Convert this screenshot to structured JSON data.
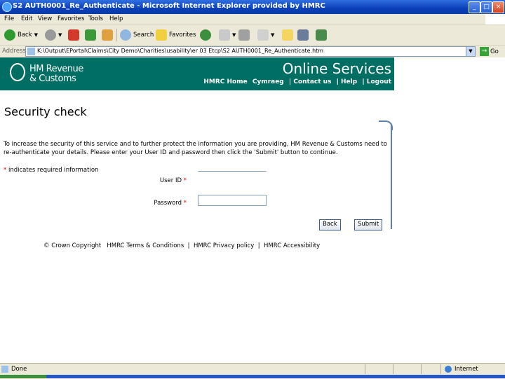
{
  "window": {
    "title": "S2 AUTH0001_Re_Authenticate - Microsoft Internet Explorer provided by HMRC"
  },
  "menu": {
    "items": [
      "File",
      "Edit",
      "View",
      "Favorites",
      "Tools",
      "Help"
    ]
  },
  "toolbar": {
    "back": "Back",
    "search": "Search",
    "favorites": "Favorites"
  },
  "address": {
    "label": "Address",
    "url": "K:\\Output\\EPortal\\Claims\\City Demo\\Charities\\usability\\er 03 Etcp\\S2 AUTH0001_Re_Authenticate.htm",
    "go": "Go"
  },
  "banner": {
    "logo_line1": "HM Revenue",
    "logo_line2": "& Customs",
    "service": "Online Services",
    "nav": [
      "HMRC Home",
      "Cymraeg",
      "| Contact us",
      "| Help",
      "| Logout"
    ]
  },
  "page": {
    "title": "Security check",
    "intro": "To increase the security of this service and to further protect the information you are providing, HM Revenue & Customs need to re-authenticate your details. Please enter your User ID and password then click the 'Submit' button to continue.",
    "required_note": "indicates required information",
    "star": "*",
    "userid_label": "User ID",
    "password_label": "Password",
    "userid_value": "",
    "password_value": "",
    "back_button": "Back",
    "submit_button": "Submit"
  },
  "footer": {
    "copyright": "© Crown Copyright",
    "links": [
      "HMRC Terms & Conditions",
      "HMRC Privacy policy",
      "HMRC Accessibility"
    ],
    "separator": "|"
  },
  "status": {
    "text": "Done",
    "zone": "Internet"
  },
  "colors": {
    "banner": "#006e63",
    "titlebar": "#0a3fb8",
    "chrome": "#ece9d8"
  }
}
